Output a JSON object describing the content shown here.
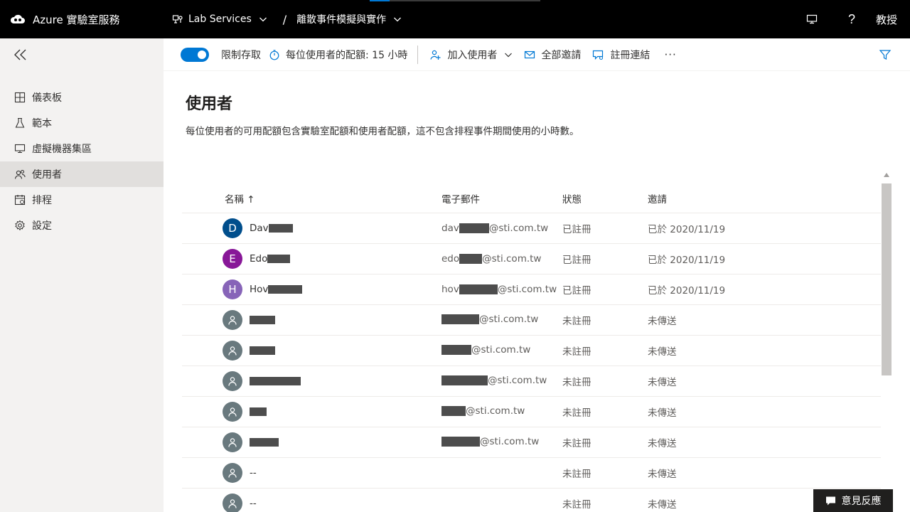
{
  "header": {
    "app_title": "Azure 實驗室服務",
    "lab_service": "Lab Services",
    "breadcrumb_sep": "/",
    "lab_name": "離散事件模擬與實作",
    "user": "教授"
  },
  "sidebar": {
    "items": [
      {
        "label": "儀表板",
        "icon": "dashboard-icon"
      },
      {
        "label": "範本",
        "icon": "flask-icon"
      },
      {
        "label": "虛擬機器集區",
        "icon": "monitor-icon"
      },
      {
        "label": "使用者",
        "icon": "users-icon"
      },
      {
        "label": "排程",
        "icon": "calendar-icon"
      },
      {
        "label": "設定",
        "icon": "gear-icon"
      }
    ]
  },
  "toolbar": {
    "restrict_access": "限制存取",
    "quota": "每位使用者的配額: 15 小時",
    "add_users": "加入使用者",
    "invite_all": "全部邀請",
    "register_link": "註冊連結",
    "more": "···"
  },
  "main": {
    "title": "使用者",
    "description": "每位使用者的可用配額包含實驗室配額和使用者配額，這不包含排程事件期間使用的小時數。"
  },
  "table": {
    "columns": {
      "name": "名稱 ↑",
      "email": "電子郵件",
      "status": "狀態",
      "invite": "邀請"
    },
    "rows": [
      {
        "initial": "D",
        "avatar_color": "#004e8c",
        "name": "Dav",
        "email_prefix": "dav",
        "email_domain": "@sti.com.tw",
        "status": "已註冊",
        "invite": "已於 2020/11/19"
      },
      {
        "initial": "E",
        "avatar_color": "#881798",
        "name": "Edo",
        "email_prefix": "edo",
        "email_domain": "@sti.com.tw",
        "status": "已註冊",
        "invite": "已於 2020/11/19"
      },
      {
        "initial": "H",
        "avatar_color": "#8764b8",
        "name": "Hov",
        "email_prefix": "hov",
        "email_domain": "@sti.com.tw",
        "status": "已註冊",
        "invite": "已於 2020/11/19"
      },
      {
        "initial": "",
        "name": "",
        "email_prefix": "",
        "email_domain": "@sti.com.tw",
        "status": "未註冊",
        "invite": "未傳送"
      },
      {
        "initial": "",
        "name": "",
        "email_prefix": "",
        "email_domain": "@sti.com.tw",
        "status": "未註冊",
        "invite": "未傳送"
      },
      {
        "initial": "",
        "name": "",
        "email_prefix": "",
        "email_domain": "@sti.com.tw",
        "status": "未註冊",
        "invite": "未傳送"
      },
      {
        "initial": "",
        "name": "",
        "email_prefix": "",
        "email_domain": "@sti.com.tw",
        "status": "未註冊",
        "invite": "未傳送"
      },
      {
        "initial": "",
        "name": "",
        "email_prefix": "",
        "email_domain": "@sti.com.tw",
        "status": "未註冊",
        "invite": "未傳送"
      },
      {
        "initial": "",
        "name": "--",
        "email_prefix": "",
        "email_domain": "",
        "status": "未註冊",
        "invite": "未傳送"
      },
      {
        "initial": "",
        "name": "--",
        "email_prefix": "",
        "email_domain": "",
        "status": "未註冊",
        "invite": "未傳送"
      }
    ]
  },
  "feedback": {
    "label": "意見反應"
  }
}
